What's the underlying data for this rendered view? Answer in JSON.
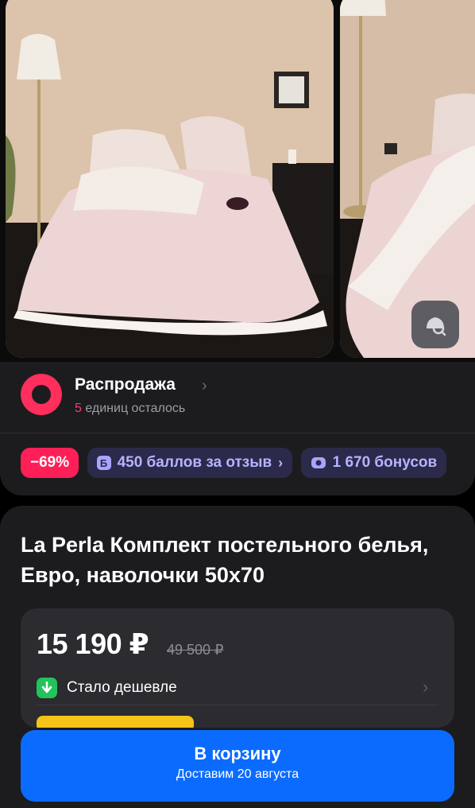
{
  "sale": {
    "title": "Распродажа",
    "chevron": "›",
    "remaining_count": "5",
    "remaining_text": " единиц осталось"
  },
  "chips": {
    "discount": "−69%",
    "review_icon": "Б",
    "review": "450 баллов за отзыв",
    "review_chevron": "›",
    "bonus": "1 670 бонусов"
  },
  "product": {
    "title": "La Perla Комплект постельного белья, Евро, наволочки 50x70"
  },
  "price": {
    "current": "15 190 ₽",
    "old": "49 500 ₽",
    "cheaper_label": "Стало дешевле",
    "chevron": "›"
  },
  "cart": {
    "label": "В корзину",
    "delivery": "Доставим 20 августа"
  },
  "colors": {
    "sale_accent": "#ff2e5c",
    "discount_chip": "#ff1f57",
    "points_chip_bg": "#2b2a4a",
    "points_chip_text": "#b7b3ff",
    "cart_button": "#0b6bff",
    "cheaper_badge": "#21c35a"
  },
  "icons": {
    "visual_search": "image-search-icon",
    "cheaper": "arrow-down-icon",
    "bonus": "coins-icon",
    "sale_logo": "sale-ring-icon"
  }
}
